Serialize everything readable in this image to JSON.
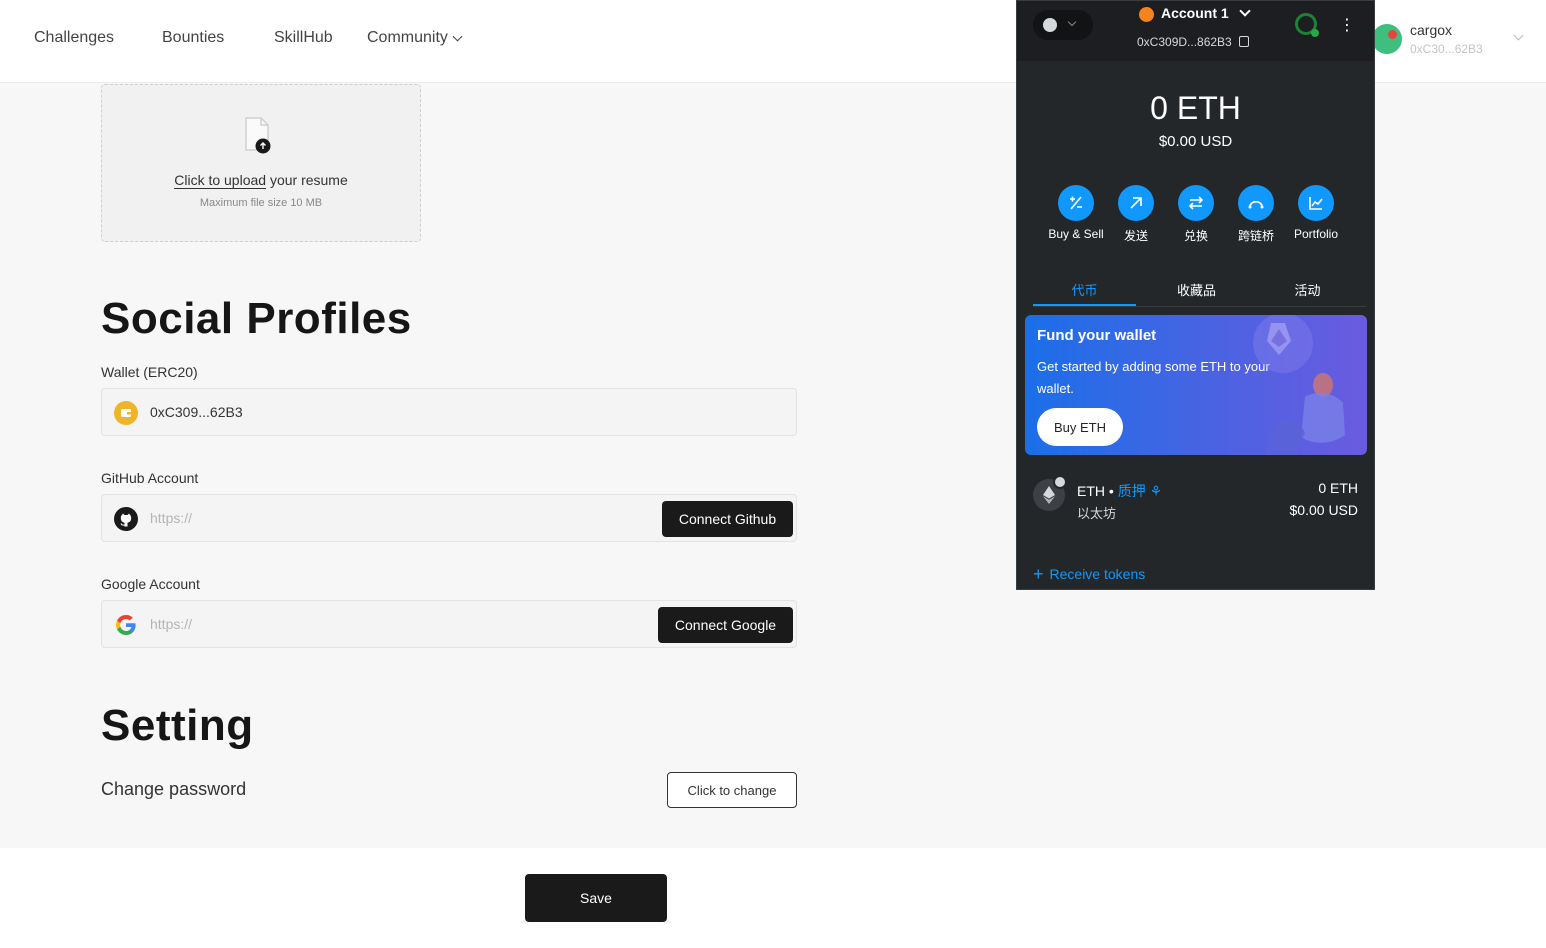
{
  "nav": {
    "links": [
      "Challenges",
      "Bounties",
      "SkillHub",
      "Community"
    ]
  },
  "user": {
    "name": "cargox",
    "address": "0xC30...62B3"
  },
  "upload": {
    "link_text": "Click to upload",
    "rest_text": " your resume",
    "hint": "Maximum file size 10 MB",
    "icon": "file-upload-icon"
  },
  "social": {
    "title": "Social Profiles",
    "wallet_label": "Wallet (ERC20)",
    "wallet_value": "0xC309...62B3",
    "github_label": "GitHub Account",
    "github_placeholder": "https://",
    "github_button": "Connect Github",
    "google_label": "Google Account",
    "google_placeholder": "https://",
    "google_button": "Connect Google"
  },
  "setting": {
    "title": "Setting",
    "password_label": "Change password",
    "password_button": "Click to change"
  },
  "save_button": "Save",
  "metamask": {
    "account_name": "Account 1",
    "account_address": "0xC309D...862B3",
    "balance": "0 ETH",
    "balance_usd": "$0.00 USD",
    "actions": [
      {
        "label": "Buy & Sell",
        "icon": "buy-sell-icon"
      },
      {
        "label": "发送",
        "icon": "send-arrow-icon"
      },
      {
        "label": "兑换",
        "icon": "swap-icon"
      },
      {
        "label": "跨链桥",
        "icon": "bridge-icon"
      },
      {
        "label": "Portfolio",
        "icon": "portfolio-chart-icon"
      }
    ],
    "tabs": [
      "代币",
      "收藏品",
      "活动"
    ],
    "active_tab": "代币",
    "fund": {
      "title": "Fund your wallet",
      "description": "Get started by adding some ETH to your wallet.",
      "button": "Buy ETH"
    },
    "token": {
      "symbol": "ETH •",
      "stake_label": "质押",
      "name": "以太坊",
      "amount": "0 ETH",
      "usd": "$0.00 USD"
    },
    "receive_link": "Receive tokens"
  },
  "colors": {
    "accent_blue": "#1098fc",
    "metamask_bg": "#24272a",
    "dark_button": "#1a1a1a",
    "wallet_icon": "#f0b429"
  }
}
